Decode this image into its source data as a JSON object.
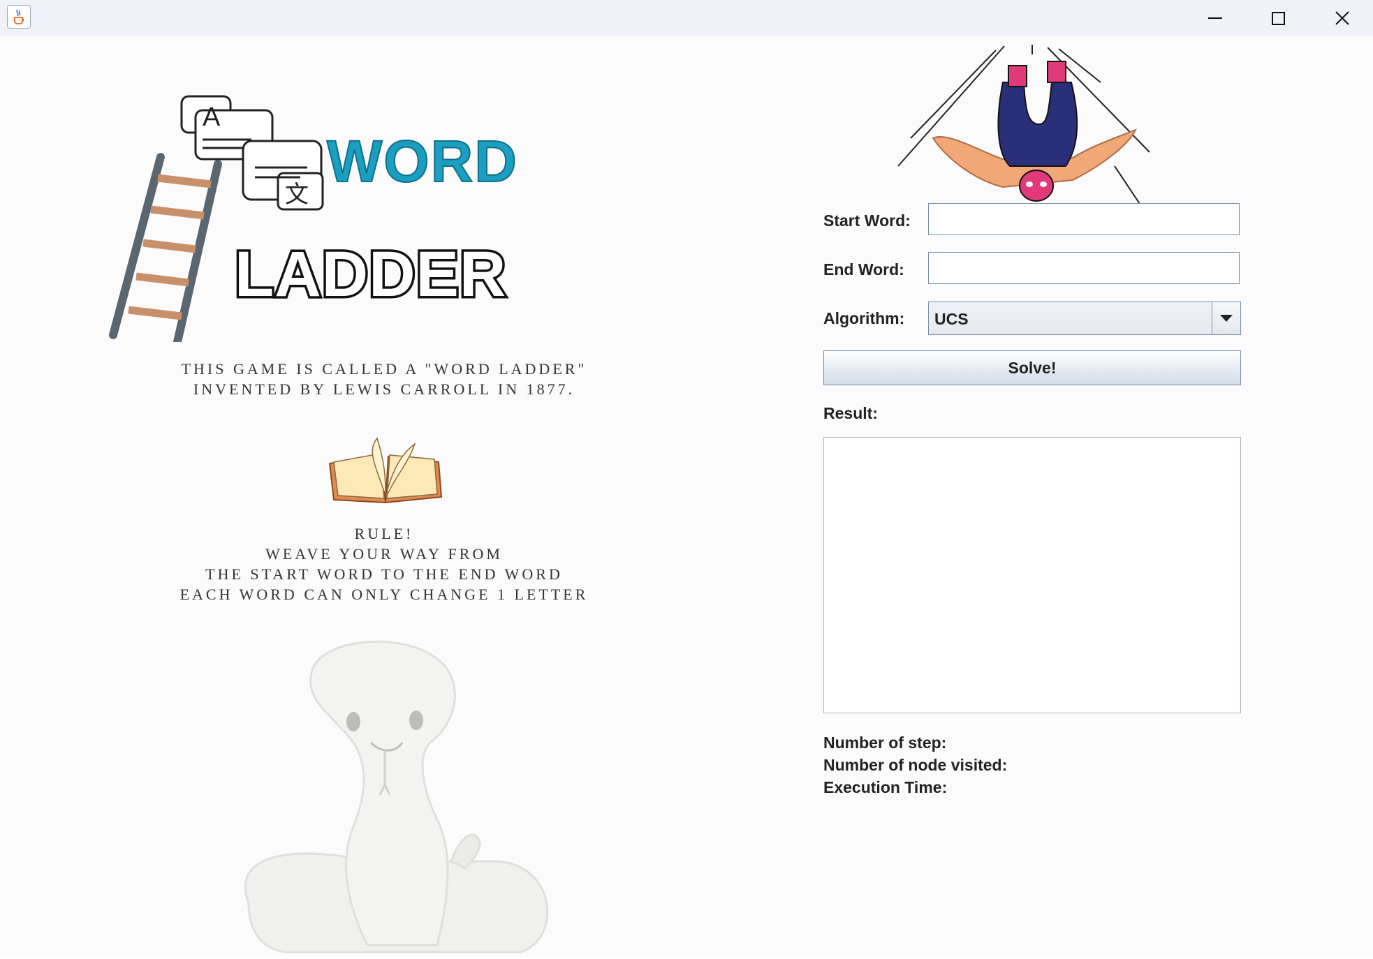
{
  "window": {
    "app_icon": "java-cup-icon",
    "controls": [
      "minimize-icon",
      "maximize-icon",
      "close-icon"
    ]
  },
  "left": {
    "logo": {
      "line1": "WORD",
      "line2": "LADDER",
      "bubble_glyphs": [
        "A",
        "文"
      ]
    },
    "intro": [
      "THIS GAME IS CALLED A \"WORD LADDER\"",
      "INVENTED BY LEWIS CARROLL IN 1877."
    ],
    "rules": [
      "RULE!",
      "WEAVE YOUR WAY FROM",
      "THE START WORD TO THE END WORD",
      "EACH WORD CAN ONLY CHANGE 1 LETTER"
    ]
  },
  "form": {
    "start_label": "Start Word:",
    "start_value": "",
    "end_label": "End Word:",
    "end_value": "",
    "algorithm_label": "Algorithm:",
    "algorithm_value": "UCS",
    "solve_label": "Solve!",
    "result_label": "Result:",
    "result_value": ""
  },
  "stats": {
    "steps_label": "Number of step:",
    "nodes_label": "Number of node visited:",
    "time_label": "Execution Time:"
  },
  "colors": {
    "word_blue": "#1a9fc0",
    "ladder_rung": "#c8906a",
    "ladder_rail": "#5a6670",
    "button_border": "#7a8ea8"
  }
}
